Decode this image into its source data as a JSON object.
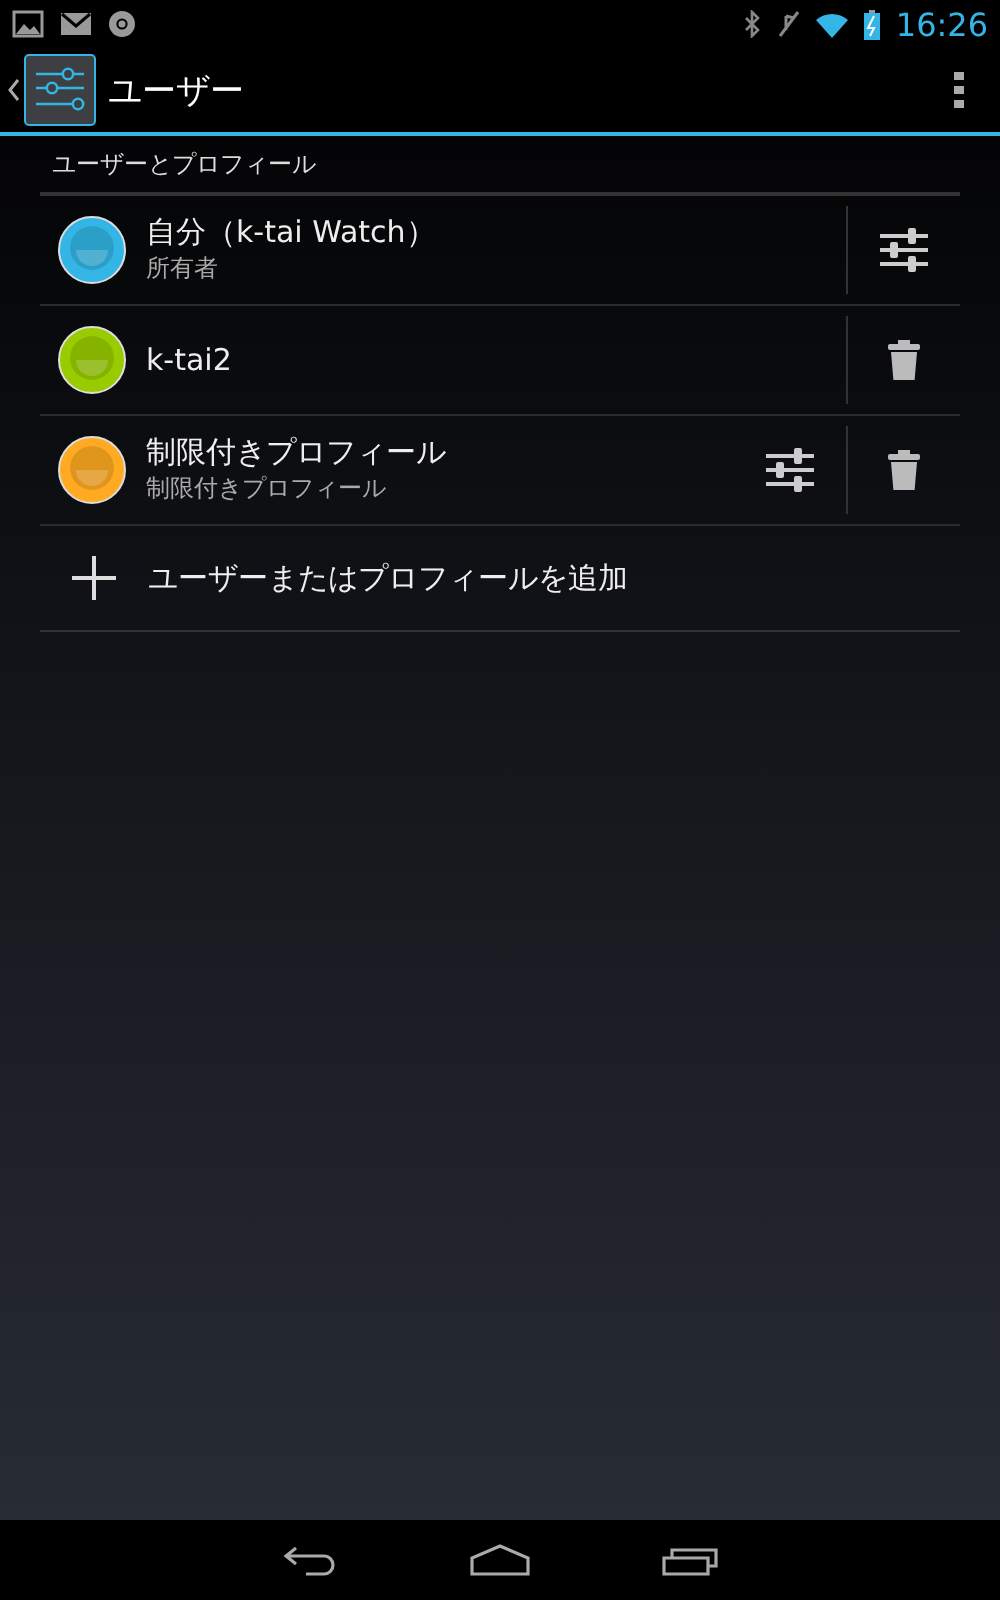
{
  "status_bar": {
    "time": "16:26"
  },
  "action_bar": {
    "title": "ユーザー"
  },
  "section": {
    "title": "ユーザーとプロフィール"
  },
  "users": [
    {
      "name": "自分（k-tai Watch）",
      "subtitle": "所有者",
      "color": "#33b5e5",
      "actions": [
        {
          "kind": "settings"
        }
      ]
    },
    {
      "name": "k-tai2",
      "color": "#99cc00",
      "actions": [
        {
          "kind": "delete"
        }
      ]
    },
    {
      "name": "制限付きプロフィール",
      "subtitle": "制限付きプロフィール",
      "color": "#ffaa22",
      "actions": [
        {
          "kind": "settings"
        },
        {
          "kind": "delete"
        }
      ]
    }
  ],
  "add_item": {
    "label": "ユーザーまたはプロフィールを追加"
  }
}
